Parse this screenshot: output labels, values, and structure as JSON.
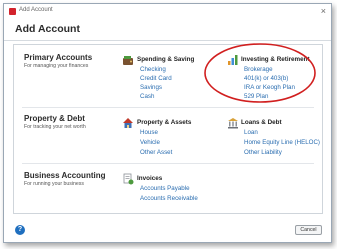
{
  "window": {
    "title": "Add Account",
    "close_glyph": "×"
  },
  "heading": "Add Account",
  "sections": {
    "primary": {
      "title": "Primary Accounts",
      "subtitle": "For managing your finances"
    },
    "property": {
      "title": "Property & Debt",
      "subtitle": "For tracking your net worth"
    },
    "business": {
      "title": "Business Accounting",
      "subtitle": "For running your business"
    }
  },
  "groups": {
    "spending": {
      "title": "Spending & Saving",
      "icon": "wallet-icon",
      "links": [
        "Checking",
        "Credit Card",
        "Savings",
        "Cash"
      ]
    },
    "investing": {
      "title": "Investing & Retirement",
      "icon": "chart-icon",
      "links": [
        "Brokerage",
        "401(k) or 403(b)",
        "IRA or Keogh Plan",
        "529 Plan"
      ]
    },
    "property_assets": {
      "title": "Property & Assets",
      "icon": "house-icon",
      "links": [
        "House",
        "Vehicle",
        "Other Asset"
      ]
    },
    "loans": {
      "title": "Loans & Debt",
      "icon": "bank-icon",
      "links": [
        "Loan",
        "Home Equity Line (HELOC)",
        "Other Liability"
      ]
    },
    "invoices": {
      "title": "Invoices",
      "icon": "invoice-icon",
      "links": [
        "Accounts Payable",
        "Accounts Receivable"
      ]
    }
  },
  "footer": {
    "help_glyph": "?",
    "cancel_label": "Cancel"
  },
  "colors": {
    "link": "#2a6db0",
    "highlight": "#d11f1f",
    "help": "#1f6fbf"
  }
}
